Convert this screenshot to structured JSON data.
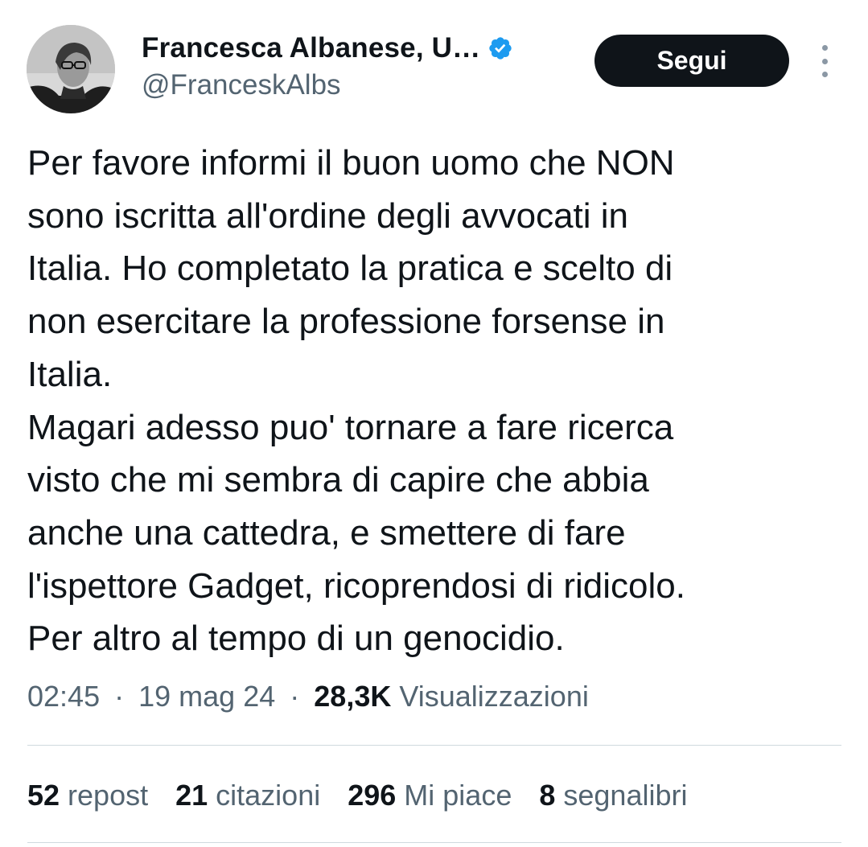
{
  "author": {
    "display_name": "Francesca Albanese, U…",
    "handle": "@FranceskAlbs",
    "avatar": "profile-photo",
    "verified_icon": "verified-badge-icon",
    "verified_color": "#1d9bf0"
  },
  "follow_button": {
    "label": "Segui"
  },
  "more_menu": {
    "icon": "vertical-ellipsis-icon"
  },
  "tweet": {
    "lines": [
      "Per favore informi il buon uomo che NON",
      "sono iscritta all'ordine degli avvocati in",
      "Italia. Ho completato la pratica e scelto di",
      "non esercitare la professione forsense in",
      "Italia.",
      "Magari adesso puo' tornare a fare ricerca",
      "visto che mi sembra di capire che abbia",
      "anche una cattedra, e smettere di fare",
      "l'ispettore Gadget, ricoprendosi di ridicolo.",
      "Per altro al tempo di un genocidio."
    ]
  },
  "meta": {
    "time": "02:45",
    "separator": "·",
    "date": "19 mag 24",
    "views_count": "28,3K",
    "views_label": "Visualizzazioni"
  },
  "stats": [
    {
      "count": "52",
      "label": "repost"
    },
    {
      "count": "21",
      "label": "citazioni"
    },
    {
      "count": "296",
      "label": "Mi piace"
    },
    {
      "count": "8",
      "label": "segnalibri"
    }
  ],
  "colors": {
    "text_primary": "#0f1419",
    "text_secondary": "#536471",
    "divider": "#cfd9de",
    "button_bg": "#0f1419"
  }
}
